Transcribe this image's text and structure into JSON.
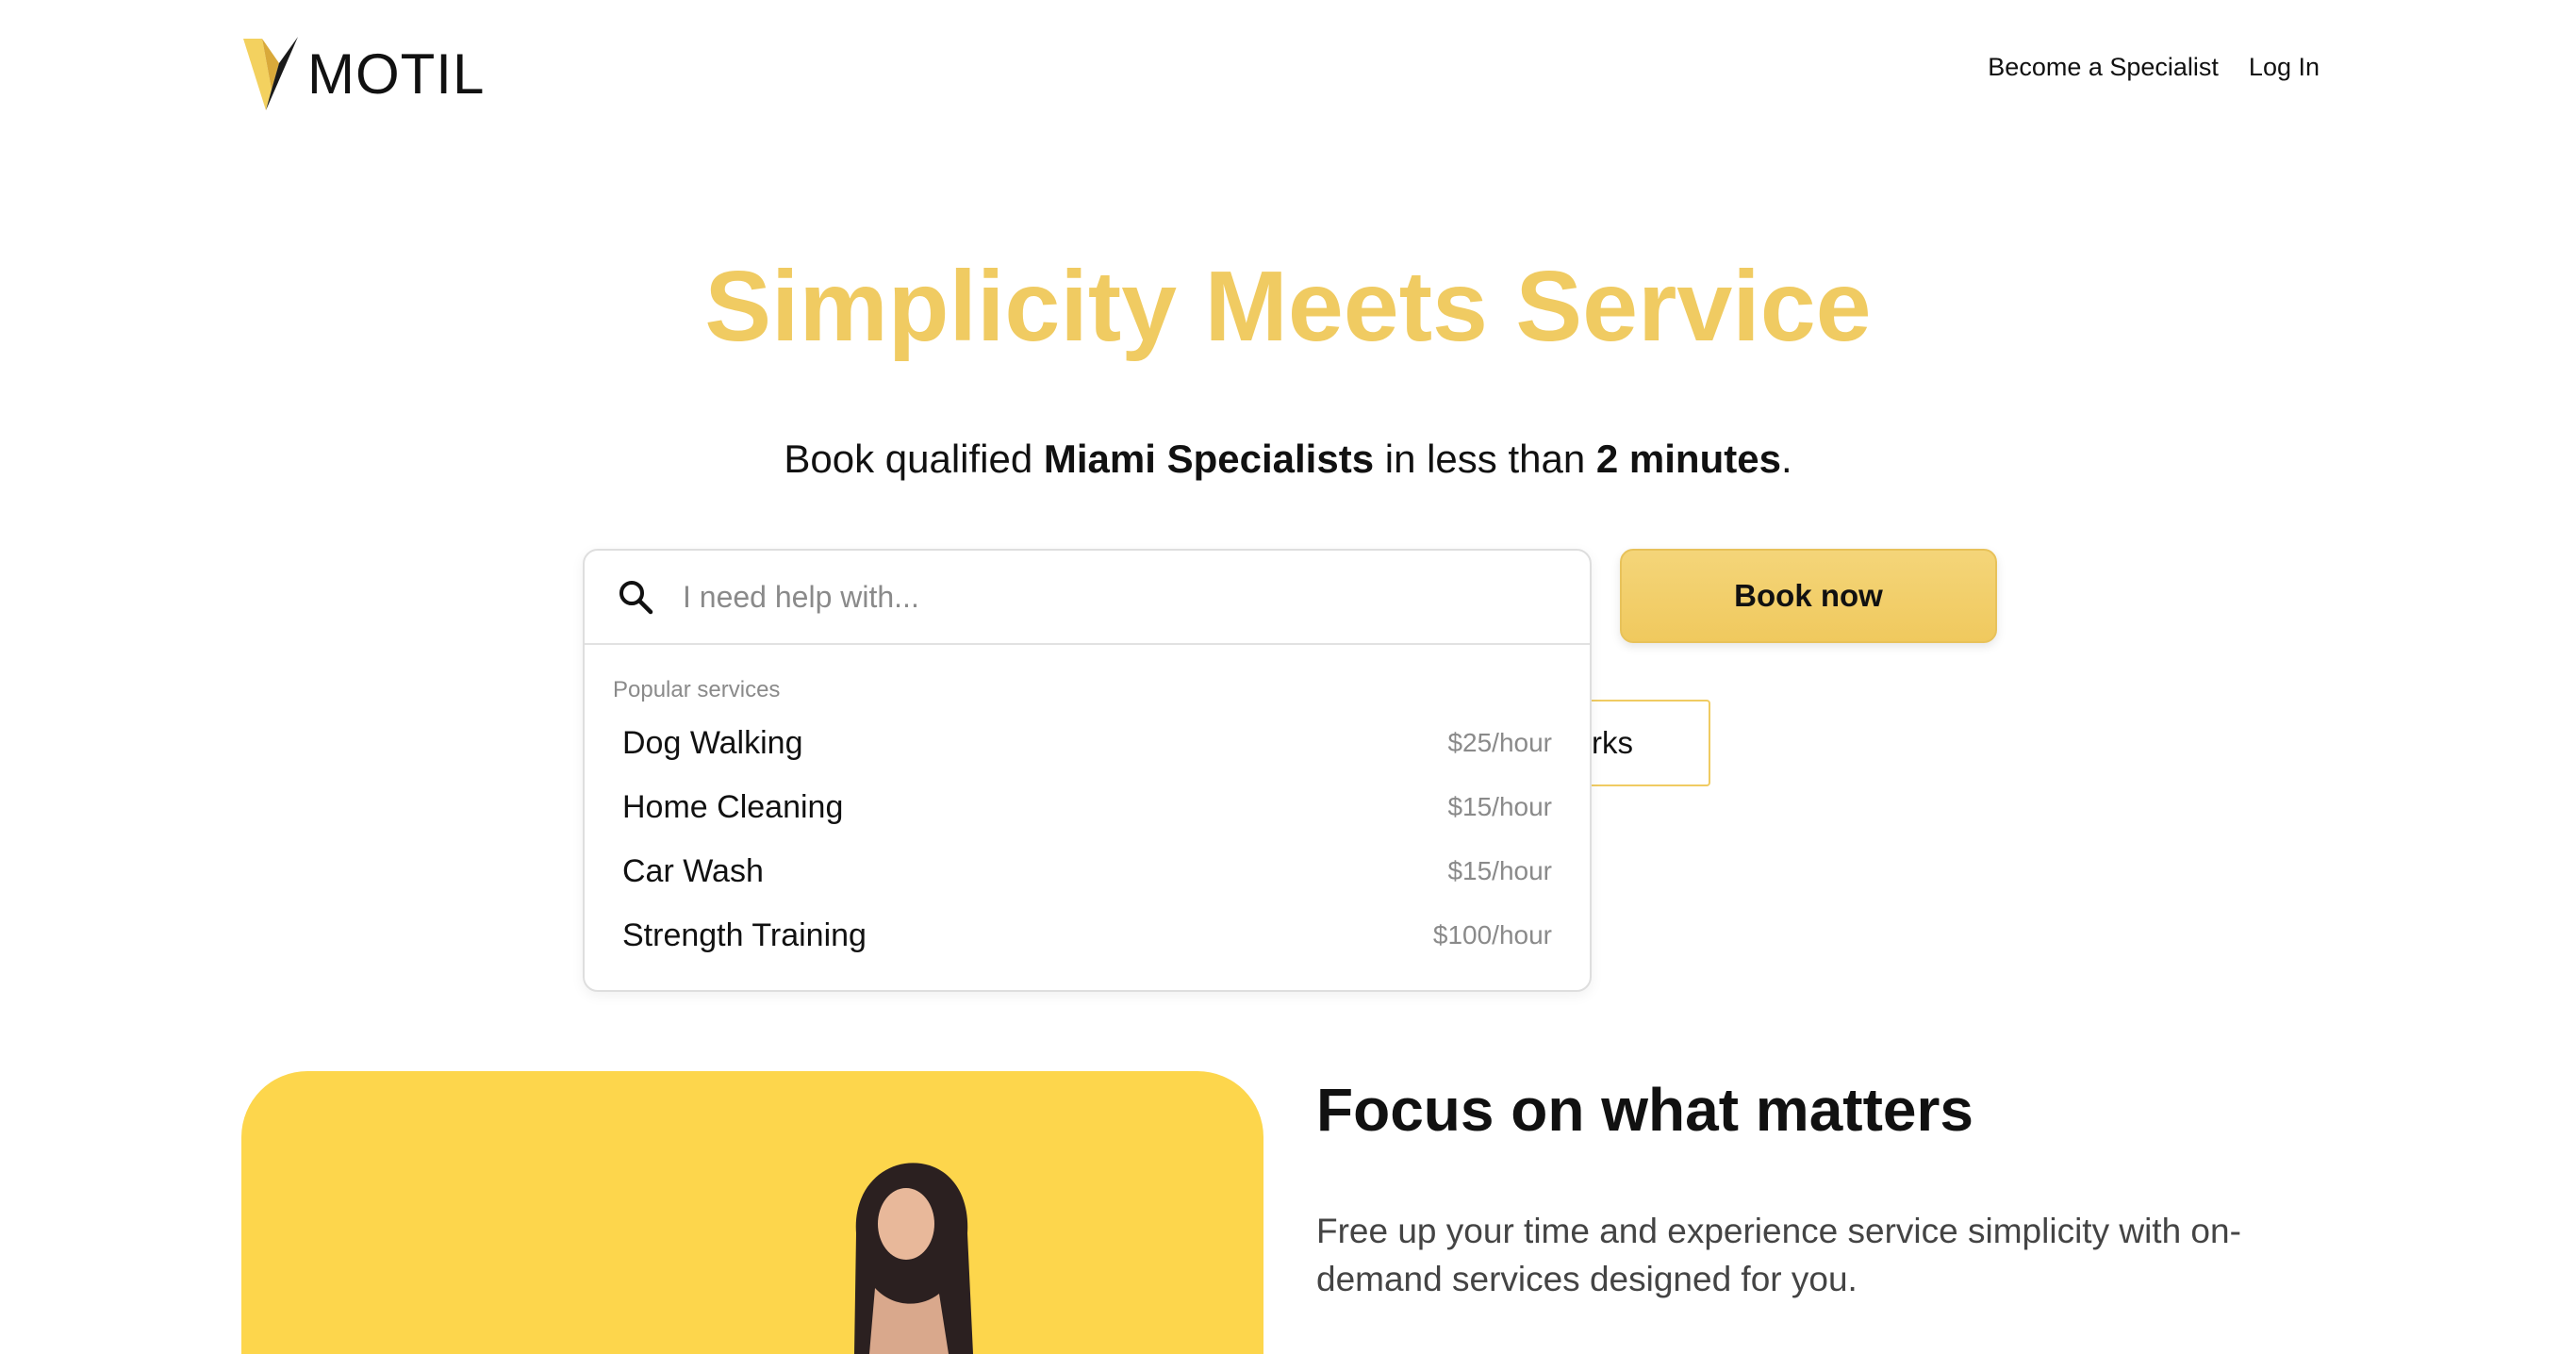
{
  "header": {
    "logo_text": "MOTIL",
    "nav": {
      "become_specialist": "Become a Specialist",
      "login": "Log In"
    }
  },
  "hero": {
    "title": "Simplicity Meets Service",
    "subtitle": {
      "pre": "Book qualified ",
      "bold1": "Miami Specialists",
      "mid": " in less than ",
      "bold2": "2 minutes",
      "post": "."
    }
  },
  "search": {
    "placeholder": "I need help with...",
    "value": "",
    "dropdown_heading": "Popular services",
    "services": [
      {
        "name": "Dog Walking",
        "price": "$25/hour"
      },
      {
        "name": "Home Cleaning",
        "price": "$15/hour"
      },
      {
        "name": "Car Wash",
        "price": "$15/hour"
      },
      {
        "name": "Strength Training",
        "price": "$100/hour"
      }
    ]
  },
  "actions": {
    "book_now": "Book now",
    "how_it_works_visible": "rks"
  },
  "focus": {
    "title": "Focus on what matters",
    "description": "Free up your time and experience service simplicity with on-demand services designed for you."
  },
  "colors": {
    "accent": "#f0cb62",
    "button": "#f2cf6b",
    "image_background": "#fdd64c"
  },
  "icons": {
    "logo": "motil-v-logo-icon",
    "search": "search-icon"
  }
}
